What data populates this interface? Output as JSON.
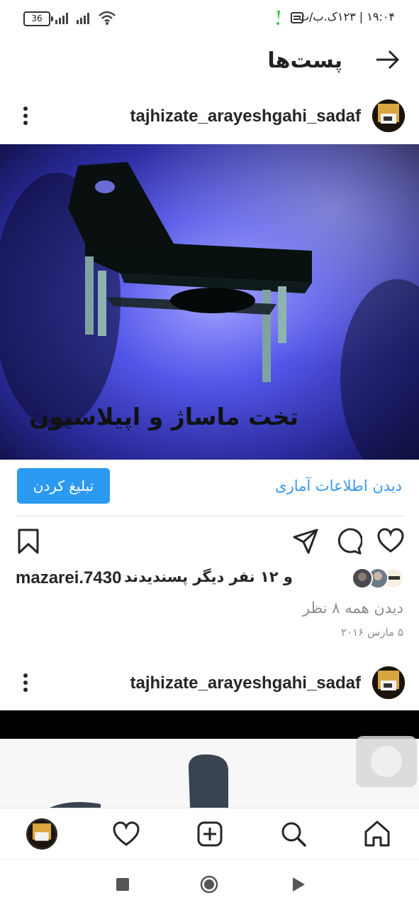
{
  "status_bar": {
    "battery": "36",
    "time_text": "۱۹:۰۴ | ۱۲۳ک.ب/ث"
  },
  "header": {
    "title": "پست‌ها"
  },
  "post": {
    "username": "tajhizate_arayeshgahi_sadaf",
    "image_caption": "تخت ماساژ و اپیلاسیون",
    "view_insights": "دیدن اطلاعات آماری",
    "promote": "تبلیغ کردن",
    "likes_text": "و ۱۲ نفر دیگر پسندیدند",
    "likes_user": "mazarei.7430",
    "view_comments": "دیدن همه ۸ نظر",
    "date": "۵ مارس ۲۰۱۶"
  },
  "post2": {
    "username": "tajhizate_arayeshgahi_sadaf"
  },
  "icons": {
    "back": "arrow-right-icon",
    "more": "more-vertical-icon",
    "save": "bookmark-icon",
    "share": "send-icon",
    "comment": "comment-icon",
    "like": "heart-icon",
    "nav": [
      "profile-avatar",
      "heart-icon",
      "plus-square-icon",
      "search-icon",
      "home-icon"
    ],
    "system": [
      "square-icon",
      "circle-icon",
      "triangle-icon"
    ]
  },
  "colors": {
    "accent": "#3897f0",
    "promote_bg": "#2a9af3",
    "image_bg": "#3b3fd8"
  }
}
